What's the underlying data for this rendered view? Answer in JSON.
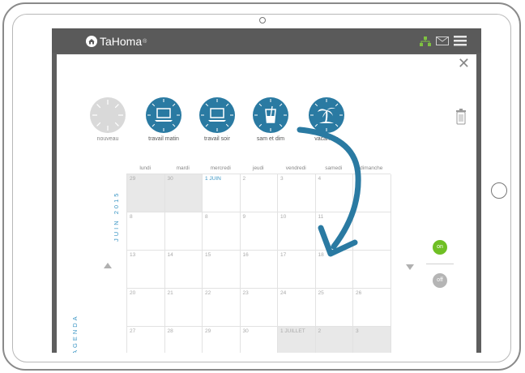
{
  "app": {
    "name": "TaHoma",
    "reg": "®"
  },
  "icons": {
    "house": "house-logo-icon",
    "network": "network-status-icon",
    "mail": "mail-icon",
    "menu": "hamburger-menu-icon",
    "close": "close-icon",
    "trash": "trash-icon"
  },
  "colors": {
    "accent": "#2a7aa2",
    "label_blue": "#3a95c4",
    "on_green": "#6fbf24",
    "off_gray": "#b5b5b5"
  },
  "scenarios": [
    {
      "label": "nouveau",
      "icon": "new-scenario-icon"
    },
    {
      "label": "travail matin",
      "icon": "laptop-icon"
    },
    {
      "label": "travail soir",
      "icon": "laptop-icon"
    },
    {
      "label": "sam et dim",
      "icon": "drink-icon"
    },
    {
      "label": "vacances",
      "icon": "palm-tree-icon"
    }
  ],
  "calendar": {
    "month_label": "JUIN 2015",
    "side_label": "AGENDA",
    "days": [
      "lundi",
      "mardi",
      "mercredi",
      "jeudi",
      "vendredi",
      "samedi",
      "dimanche"
    ],
    "weeks": [
      [
        "29",
        "30",
        "1 JUIN",
        "2",
        "3",
        "4",
        ""
      ],
      [
        "8",
        "",
        "8",
        "9",
        "10",
        "11",
        ""
      ],
      [
        "13",
        "14",
        "15",
        "16",
        "17",
        "18",
        ""
      ],
      [
        "20",
        "21",
        "22",
        "23",
        "24",
        "25",
        "26"
      ],
      [
        "27",
        "28",
        "29",
        "30",
        "1 JUILLET",
        "2",
        "3"
      ]
    ]
  },
  "toggle": {
    "on": "on",
    "off": "off"
  }
}
